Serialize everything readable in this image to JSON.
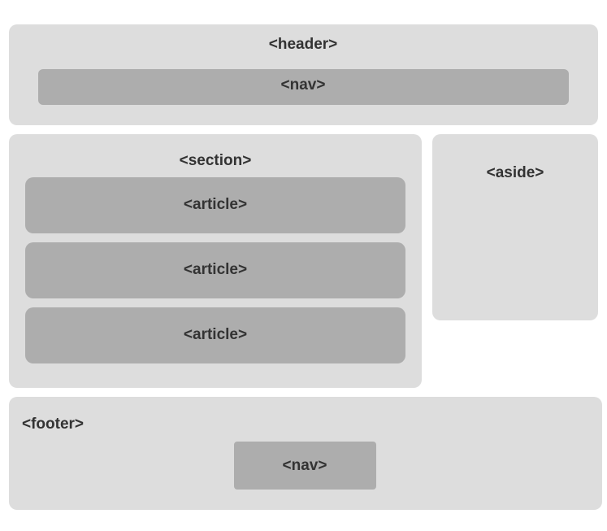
{
  "header": {
    "label": "<header>",
    "nav_label": "<nav>"
  },
  "section": {
    "label": "<section>",
    "articles": [
      {
        "label": "<article>"
      },
      {
        "label": "<article>"
      },
      {
        "label": "<article>"
      }
    ]
  },
  "aside": {
    "label": "<aside>"
  },
  "footer": {
    "label": "<footer>",
    "nav_label": "<nav>"
  },
  "colors": {
    "container": "#dddddd",
    "inner": "#adadad",
    "text": "#333333"
  }
}
